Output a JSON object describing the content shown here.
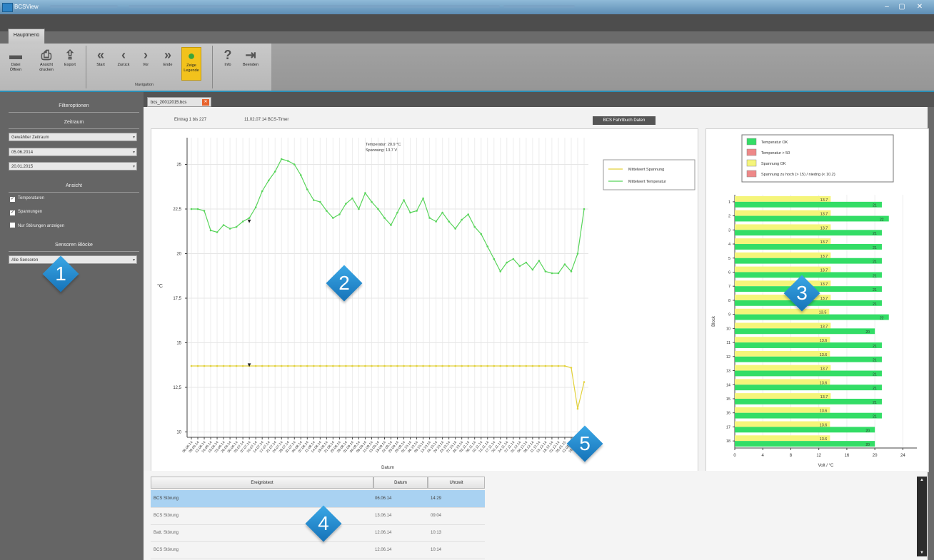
{
  "window": {
    "title": "BCSView",
    "min": "–",
    "max": "▢",
    "close": "✕"
  },
  "ribbon": {
    "main_tab": "Hauptmenü",
    "buttons": [
      {
        "id": "open",
        "icon": "folder-icon",
        "label": "Datei\nÖffnen"
      },
      {
        "id": "print",
        "icon": "printer-icon",
        "label": "Ansicht\ndrucken"
      },
      {
        "id": "export",
        "icon": "export-icon",
        "label": "Export"
      },
      {
        "id": "start",
        "icon": "double-left-icon",
        "label": "Start"
      },
      {
        "id": "back",
        "icon": "left-icon",
        "label": "Zurück"
      },
      {
        "id": "next",
        "icon": "right-icon",
        "label": "Vor"
      },
      {
        "id": "end",
        "icon": "double-right-icon",
        "label": "Ende"
      },
      {
        "id": "legend",
        "icon": "legend-icon",
        "label": "Zeige\nLegende"
      },
      {
        "id": "info",
        "icon": "info-icon",
        "label": "Info"
      },
      {
        "id": "exit",
        "icon": "exit-icon",
        "label": "Beenden"
      }
    ],
    "group_navigation": "Navigation"
  },
  "sidebar": {
    "filter_title": "Filteroptionen",
    "zeitraum_title": "Zeitraum",
    "zeitraum_select": "Gewählter Zeitraum",
    "date_from": "05.06.2014",
    "date_to": "20.01.2015",
    "ansicht_title": "Ansicht",
    "check_temp": "Temperaturen",
    "check_spann": "Spannungen",
    "check_stoer": "Nur Störungen anzeigen",
    "sensor_title": "Sensoren Blöcke",
    "sensor_select": "Alle Sensoren"
  },
  "doc": {
    "tab_label": "bcs_20012015.bcs",
    "info_eintrag": "Eintrag 1 bis 227",
    "info_time": "11.02.07:14  BCS-Timer",
    "fahrtbuch_btn": "BCS Fahrtbuch Daten"
  },
  "linechart": {
    "readout_temp": "Temperatur: 20.9 °C",
    "readout_spann": "Spannung: 13.7 V",
    "legend": [
      "Mittelwert Spannung",
      "Mittelwert Temperatur"
    ],
    "ylabel": "°C",
    "xlabel": "Datum"
  },
  "barchart": {
    "legend": [
      "Temperatur OK",
      "Temperatur > 50",
      "Spannung OK",
      "Spannung zu hoch (> 15) / niedrig (< 10.2)"
    ],
    "ylabel": "Block",
    "xlabel": "Volt / °C"
  },
  "table": {
    "headers": [
      "Ereignistext",
      "Datum",
      "Uhrzeit"
    ],
    "rows": [
      {
        "text": "BCS Störung",
        "date": "06.06.14",
        "time": "14:29",
        "selected": true
      },
      {
        "text": "BCS Störung",
        "date": "13.06.14",
        "time": "09:04",
        "selected": false
      },
      {
        "text": "Batt. Störung",
        "date": "12.06.14",
        "time": "10:13",
        "selected": false
      },
      {
        "text": "BCS Störung",
        "date": "12.06.14",
        "time": "10:14",
        "selected": false
      }
    ]
  },
  "badges": [
    "1",
    "2",
    "3",
    "4",
    "5"
  ],
  "colors": {
    "temp_ok": "#33dd66",
    "spann_ok": "#f5f57a",
    "alarm": "#ee8888",
    "accent": "#2a8fb7",
    "badge": "#1f88cf",
    "selection": "#a9d2f2"
  },
  "chart_data": [
    {
      "type": "line",
      "xlabel": "Datum",
      "ylabel": "°C",
      "ylim": [
        9.7,
        26.5
      ],
      "yticks": [
        10,
        12.5,
        15,
        17.5,
        20,
        22.5,
        25
      ],
      "x": [
        "06.06.14",
        "09.06.14",
        "12.06.14",
        "16.06.14",
        "19.06.14",
        "23.06.14",
        "26.06.14",
        "30.06.14",
        "03.07.14",
        "07.07.14",
        "10.07.14",
        "14.07.14",
        "17.07.14",
        "21.07.14",
        "24.07.14",
        "28.07.14",
        "31.07.14",
        "04.08.14",
        "07.08.14",
        "11.08.14",
        "14.08.14",
        "18.08.14",
        "21.08.14",
        "25.08.14",
        "28.08.14",
        "01.09.14",
        "04.09.14",
        "08.09.14",
        "11.09.14",
        "15.09.14",
        "18.09.14",
        "22.09.14",
        "25.09.14",
        "29.09.14",
        "02.10.14",
        "06.10.14",
        "09.10.14",
        "13.10.14",
        "16.10.14",
        "20.10.14",
        "23.10.14",
        "27.10.14",
        "30.10.14",
        "03.11.14",
        "06.11.14",
        "10.11.14",
        "13.11.14",
        "17.11.14",
        "20.11.14",
        "24.11.14",
        "27.11.14",
        "01.12.14",
        "04.12.14",
        "08.12.14",
        "11.12.14",
        "15.12.14",
        "18.12.14",
        "22.12.14",
        "05.01.15",
        "12.01.15",
        "16.01.15",
        "20.01.15"
      ],
      "series": [
        {
          "name": "Mittelwert Temperatur",
          "values": [
            22.5,
            22.5,
            22.4,
            21.3,
            21.2,
            21.6,
            21.4,
            21.5,
            21.8,
            22.0,
            22.6,
            23.5,
            24.1,
            24.6,
            25.3,
            25.2,
            25.0,
            24.4,
            23.6,
            23.0,
            22.9,
            22.4,
            22.0,
            22.2,
            22.8,
            23.1,
            22.5,
            23.4,
            22.9,
            22.5,
            22.0,
            21.6,
            22.3,
            23.0,
            22.3,
            22.4,
            23.1,
            22.0,
            21.8,
            22.3,
            21.8,
            21.4,
            21.9,
            22.2,
            21.5,
            21.1,
            20.4,
            19.7,
            19.0,
            19.5,
            19.7,
            19.3,
            19.5,
            19.1,
            19.6,
            19.0,
            18.9,
            18.9,
            19.4,
            19.0,
            20.0,
            22.5
          ]
        },
        {
          "name": "Mittelwert Spannung",
          "values": [
            13.7,
            13.7,
            13.7,
            13.7,
            13.7,
            13.7,
            13.7,
            13.7,
            13.7,
            13.7,
            13.7,
            13.7,
            13.7,
            13.7,
            13.7,
            13.7,
            13.7,
            13.7,
            13.7,
            13.7,
            13.7,
            13.7,
            13.7,
            13.7,
            13.7,
            13.7,
            13.7,
            13.7,
            13.7,
            13.7,
            13.7,
            13.7,
            13.7,
            13.7,
            13.7,
            13.7,
            13.7,
            13.7,
            13.7,
            13.7,
            13.7,
            13.7,
            13.7,
            13.7,
            13.7,
            13.7,
            13.7,
            13.7,
            13.7,
            13.7,
            13.7,
            13.7,
            13.7,
            13.7,
            13.7,
            13.7,
            13.7,
            13.7,
            13.7,
            13.6,
            11.3,
            12.8
          ]
        }
      ]
    },
    {
      "type": "bar",
      "orientation": "horizontal",
      "xlabel": "Volt / °C",
      "ylabel": "Block",
      "xlim": [
        0,
        26
      ],
      "xticks": [
        0,
        4,
        8,
        12,
        16,
        20,
        24
      ],
      "categories": [
        "1",
        "2",
        "3",
        "4",
        "5",
        "6",
        "7",
        "8",
        "9",
        "10",
        "11",
        "12",
        "13",
        "14",
        "15",
        "16",
        "17",
        "18"
      ],
      "series": [
        {
          "name": "Spannung OK",
          "values": [
            13.7,
            13.7,
            13.7,
            13.7,
            13.7,
            13.7,
            13.7,
            13.7,
            13.5,
            13.7,
            13.6,
            13.6,
            13.7,
            13.6,
            13.7,
            13.6,
            13.6,
            13.6
          ]
        },
        {
          "name": "Temperatur OK",
          "values": [
            21,
            22,
            21,
            21,
            21,
            21,
            21,
            21,
            22,
            20,
            21,
            21,
            21,
            21,
            21,
            21,
            20,
            20
          ]
        }
      ]
    }
  ]
}
